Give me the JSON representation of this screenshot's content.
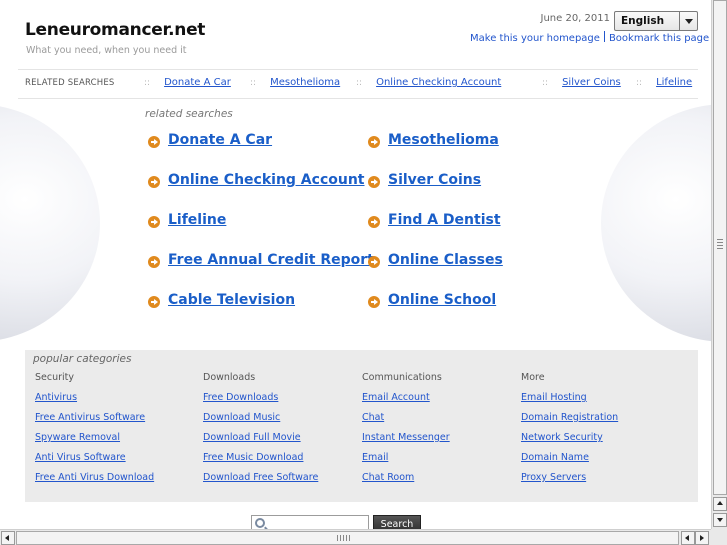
{
  "header": {
    "site_title": "Leneuromancer.net",
    "tagline": "What you need, when you need it",
    "date": "June 20, 2011",
    "language": "English",
    "homepage_link": "Make this your homepage",
    "bookmark_link": "Bookmark this page"
  },
  "related_bar": {
    "label": "RELATED SEARCHES",
    "separator": "::",
    "items": [
      "Donate A Car",
      "Mesothelioma",
      "Online Checking Account",
      "Silver Coins",
      "Lifeline"
    ]
  },
  "related_searches": {
    "heading": "related searches",
    "items": [
      "Donate A Car",
      "Mesothelioma",
      "Online Checking Account",
      "Silver Coins",
      "Lifeline",
      "Find A Dentist",
      "Free Annual Credit Report",
      "Online Classes",
      "Cable Television",
      "Online School"
    ]
  },
  "popular_categories": {
    "title": "popular categories",
    "columns": [
      {
        "heading": "Security",
        "links": [
          "Antivirus",
          "Free Antivirus Software",
          "Spyware Removal",
          "Anti Virus Software",
          "Free Anti Virus Download"
        ]
      },
      {
        "heading": "Downloads",
        "links": [
          "Free Downloads",
          "Download Music",
          "Download Full Movie",
          "Free Music Download",
          "Download Free Software"
        ]
      },
      {
        "heading": "Communications",
        "links": [
          "Email Account",
          "Chat",
          "Instant Messenger",
          "Email",
          "Chat Room"
        ]
      },
      {
        "heading": "More",
        "links": [
          "Email Hosting",
          "Domain Registration",
          "Network Security",
          "Domain Name",
          "Proxy Servers"
        ]
      }
    ]
  },
  "search": {
    "placeholder": "",
    "button_label": "Search"
  },
  "colors": {
    "link": "#1a5ec8",
    "arrow_icon": "#e08a1e",
    "category_bg": "#ebebeb"
  }
}
